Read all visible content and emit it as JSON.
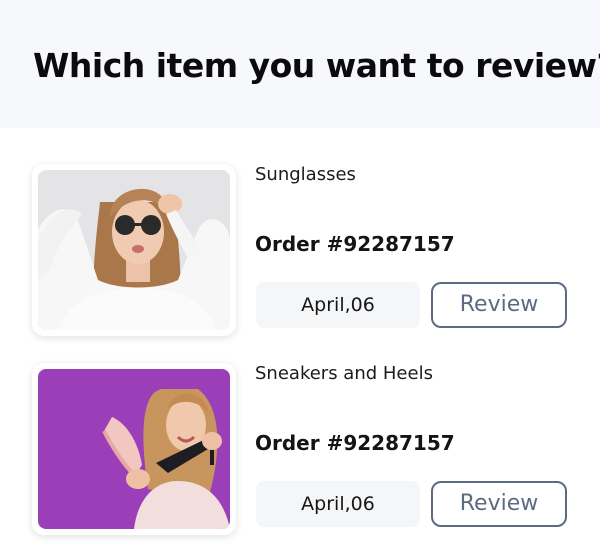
{
  "header": {
    "title": "Which item you want to review?"
  },
  "items": [
    {
      "name": "Sunglasses",
      "order": "Order #92287157",
      "date": "April,06",
      "review_label": "Review",
      "image": "woman-with-sunglasses-photo"
    },
    {
      "name": "Sneakers and Heels",
      "order": "Order #92287157",
      "date": "April,06",
      "review_label": "Review",
      "image": "woman-holding-sneaker-and-heel-photo"
    }
  ],
  "colors": {
    "header_bg": "#f6f8fc",
    "review_border": "#5d6b82",
    "date_chip_bg": "#f5f6f8",
    "photo2_bg": "#9b3fb8"
  }
}
